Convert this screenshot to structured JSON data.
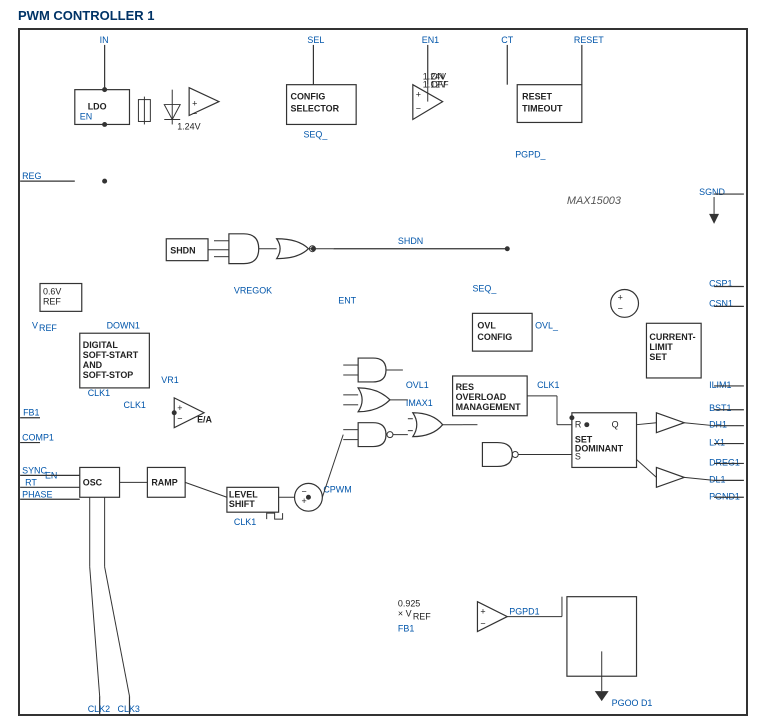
{
  "title": "PWM CONTROLLER 1",
  "chip": "MAX15003",
  "pins": {
    "left": [
      "REG",
      "FB1",
      "COMP1",
      "SYNC",
      "RT",
      "PHASE"
    ],
    "right": [
      "SGND",
      "CSP1",
      "CSN1",
      "ILIM1",
      "BST1",
      "DH1",
      "LX1",
      "DREG1",
      "DL1",
      "PGND1"
    ],
    "top": [
      "IN",
      "SEL",
      "EN1",
      "CT",
      "RESET"
    ],
    "bottom": [
      "CLK2",
      "CLK3",
      "PGOO D1"
    ]
  },
  "blocks": {
    "ldo": "LDO",
    "config_selector": "CONFIG SELECTOR",
    "reset_timeout": "RESET TIMEOUT",
    "digital_soft": "DIGITAL SOFT-START AND SOFT-STOP",
    "osc": "OSC",
    "ramp": "RAMP",
    "level_shift": "LEVEL SHIFT",
    "ea": "E/A",
    "ovl_config": "OVL CONFIG",
    "overload_mgmt": "OVERLOAD MANAGEMENT",
    "current_limit": "CURRENT-LIMIT SET",
    "set_dominant": "SET DOMINANT"
  },
  "signals": {
    "shdn": "SHDN",
    "vregok": "VREGOK",
    "ent": "ENT",
    "seq_": "SEQ_",
    "ovl_": "OVL_",
    "ovl1": "OVL1",
    "imax1": "IMAX1",
    "clk1": "CLK1",
    "cpwm": "CPWM",
    "pgpd_": "PGPD_",
    "pgpd1": "PGPD1",
    "down1": "DOWN1",
    "vr1": "VR1",
    "vref": "VREF",
    "clk1_label": "CLK1",
    "v124": "1.24V",
    "v06ref": "0.6V REF",
    "v0925": "0.925 × VREF"
  }
}
